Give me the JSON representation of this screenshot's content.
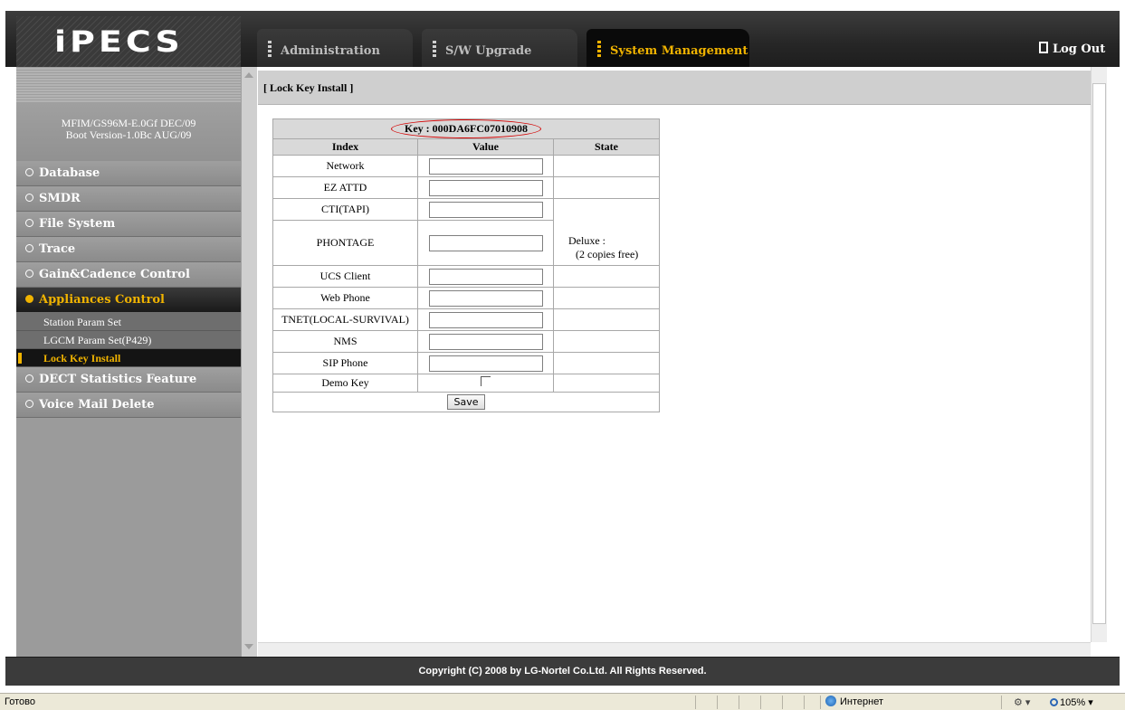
{
  "header": {
    "logo": "iPECS",
    "tabs": [
      {
        "label": "Administration"
      },
      {
        "label": "S/W Upgrade"
      },
      {
        "label": "System Management",
        "active": true
      }
    ],
    "logout_label": "Log Out"
  },
  "sidebar": {
    "version_line1": "MFIM/GS96M-E.0Gf DEC/09",
    "version_line2": "Boot Version-1.0Bc AUG/09",
    "menu": [
      {
        "label": "Database"
      },
      {
        "label": "SMDR"
      },
      {
        "label": "File System"
      },
      {
        "label": "Trace"
      },
      {
        "label": "Gain&Cadence Control"
      },
      {
        "label": "Appliances Control",
        "active": true
      },
      {
        "label": "DECT Statistics Feature"
      },
      {
        "label": "Voice Mail Delete"
      }
    ],
    "submenu": [
      {
        "label": "Station Param Set"
      },
      {
        "label": "LGCM Param Set(P429)"
      },
      {
        "label": "Lock Key Install",
        "active": true
      }
    ]
  },
  "content": {
    "page_title": "[ Lock Key Install ]",
    "key_label": "Key : 000DA6FC07010908",
    "columns": [
      "Index",
      "Value",
      "State"
    ],
    "rows": [
      {
        "index": "Network",
        "value": "",
        "state": ""
      },
      {
        "index": "EZ ATTD",
        "value": "",
        "state": ""
      },
      {
        "index": "CTI(TAPI)",
        "value": "",
        "state": ""
      },
      {
        "index": "PHONTAGE",
        "value": "",
        "state_line1": "Deluxe :",
        "state_line2": "(2 copies free)"
      },
      {
        "index": "UCS Client",
        "value": "",
        "state": ""
      },
      {
        "index": "Web Phone",
        "value": "",
        "state": ""
      },
      {
        "index": "TNET(LOCAL-SURVIVAL)",
        "value": "",
        "state": ""
      },
      {
        "index": "NMS",
        "value": "",
        "state": ""
      },
      {
        "index": "SIP Phone",
        "value": "",
        "state": ""
      }
    ],
    "demo_key_label": "Demo Key",
    "demo_key_checked": false,
    "save_label": "Save"
  },
  "footer": {
    "copyright": "Copyright (C) 2008 by LG-Nortel Co.Ltd. All Rights Reserved."
  },
  "statusbar": {
    "status": "Готово",
    "zone": "Интернет",
    "zoom": "105%"
  },
  "colors": {
    "accent": "#f0b300",
    "key_circle": "#d40000"
  }
}
